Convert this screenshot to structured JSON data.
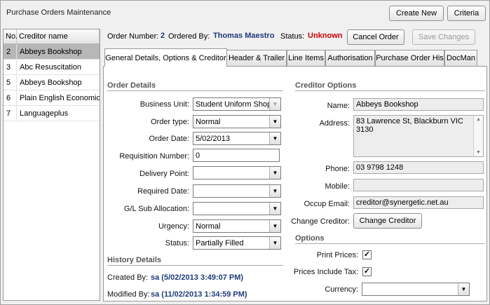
{
  "window": {
    "title": "Purchase Orders Maintenance",
    "create_new": "Create New",
    "criteria": "Criteria"
  },
  "grid": {
    "col_no": "No.",
    "col_name": "Creditor name",
    "rows": [
      {
        "no": "2",
        "name": "Abbeys Bookshop",
        "selected": true
      },
      {
        "no": "3",
        "name": "Abc Resuscitation"
      },
      {
        "no": "5",
        "name": "Abbeys Bookshop"
      },
      {
        "no": "6",
        "name": "Plain English Economics"
      },
      {
        "no": "7",
        "name": "Languageplus"
      }
    ]
  },
  "order_header": {
    "order_number_label": "Order Number:",
    "order_number": "2",
    "ordered_by_label": "Ordered By:",
    "ordered_by": "Thomas Maestro",
    "status_label": "Status:",
    "status": "Unknown",
    "status_color": "#cc0000",
    "cancel_order": "Cancel Order",
    "save_changes": "Save Changes"
  },
  "tabs": [
    {
      "label": "General Details, Options & Creditor",
      "active": true
    },
    {
      "label": "Header & Trailer"
    },
    {
      "label": "Line Items"
    },
    {
      "label": "Authorisation"
    },
    {
      "label": "Purchase Order His"
    },
    {
      "label": "DocMan"
    }
  ],
  "order_details": {
    "title": "Order Details",
    "business_unit_label": "Business Unit:",
    "business_unit": "Student Uniform Shop",
    "order_type_label": "Order type:",
    "order_type": "Normal",
    "order_date_label": "Order Date:",
    "order_date": "5/02/2013",
    "requisition_label": "Requisition Number:",
    "requisition": "0",
    "delivery_point_label": "Delivery Point:",
    "delivery_point": "",
    "required_date_label": "Required Date:",
    "required_date": "",
    "gl_label": "G/L Sub Allocation:",
    "gl": "",
    "urgency_label": "Urgency:",
    "urgency": "Normal",
    "status_label": "Status:",
    "status": "Partially Filled"
  },
  "history": {
    "title": "History Details",
    "created_label": "Created By:",
    "created": "sa (5/02/2013 3:49:07 PM)",
    "modified_label": "Modified By:",
    "modified": "sa (11/02/2013 1:34:59 PM)"
  },
  "creditor": {
    "title": "Creditor Options",
    "name_label": "Name:",
    "name": "Abbeys Bookshop",
    "address_label": "Address:",
    "address_line1": "83 Lawrence St, Blackburn VIC",
    "address_line2": "3130",
    "phone_label": "Phone:",
    "phone": "03 9798 1248",
    "mobile_label": "Mobile:",
    "mobile": "",
    "email_label": "Occup Email:",
    "email": "creditor@synergetic.net.au",
    "change_label": "Change Creditor:",
    "change_button": "Change Creditor"
  },
  "options": {
    "title": "Options",
    "print_prices_label": "Print Prices:",
    "print_prices": true,
    "include_tax_label": "Prices Include Tax:",
    "include_tax": true,
    "currency_label": "Currency:",
    "currency": ""
  }
}
